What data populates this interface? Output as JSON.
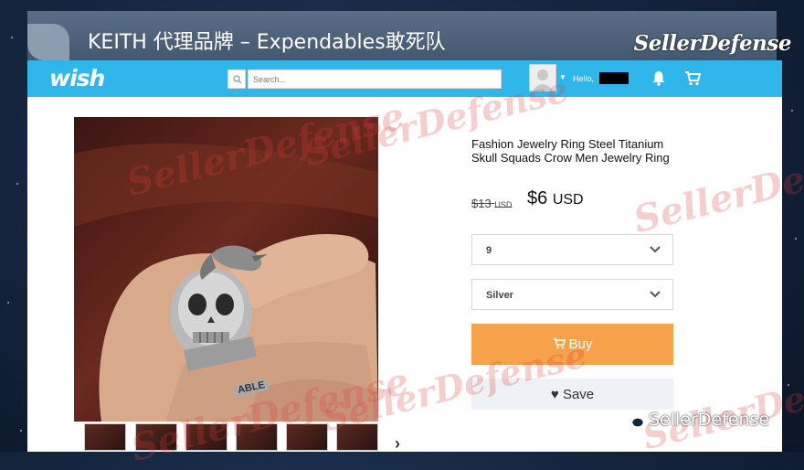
{
  "slide": {
    "title": "KEITH 代理品牌 – Expendables敢死队",
    "brand_logo": "SellerDefense"
  },
  "wish": {
    "logo": "wish",
    "search": {
      "placeholder": "Search..."
    },
    "user": {
      "greeting": "Hello,"
    }
  },
  "product": {
    "title": "Fashion Jewelry Ring Steel Titanium Skull Squads Crow Men Jewelry Ring",
    "old_price": "$13",
    "old_currency": "USD",
    "new_price": "$6",
    "new_currency": "USD",
    "size_select": {
      "value": "9"
    },
    "color_select": {
      "value": "Silver"
    },
    "buy_label": "Buy",
    "save_label": "Save",
    "thumbnail_count": 6,
    "ring_engraving": "ABLE"
  },
  "watermark_text": "SellerDefense",
  "footer_credit": "SellerDefense",
  "colors": {
    "wish_blue": "#2fb7ec",
    "buy_orange": "#f5a24a",
    "save_bg": "#eef1f5"
  }
}
